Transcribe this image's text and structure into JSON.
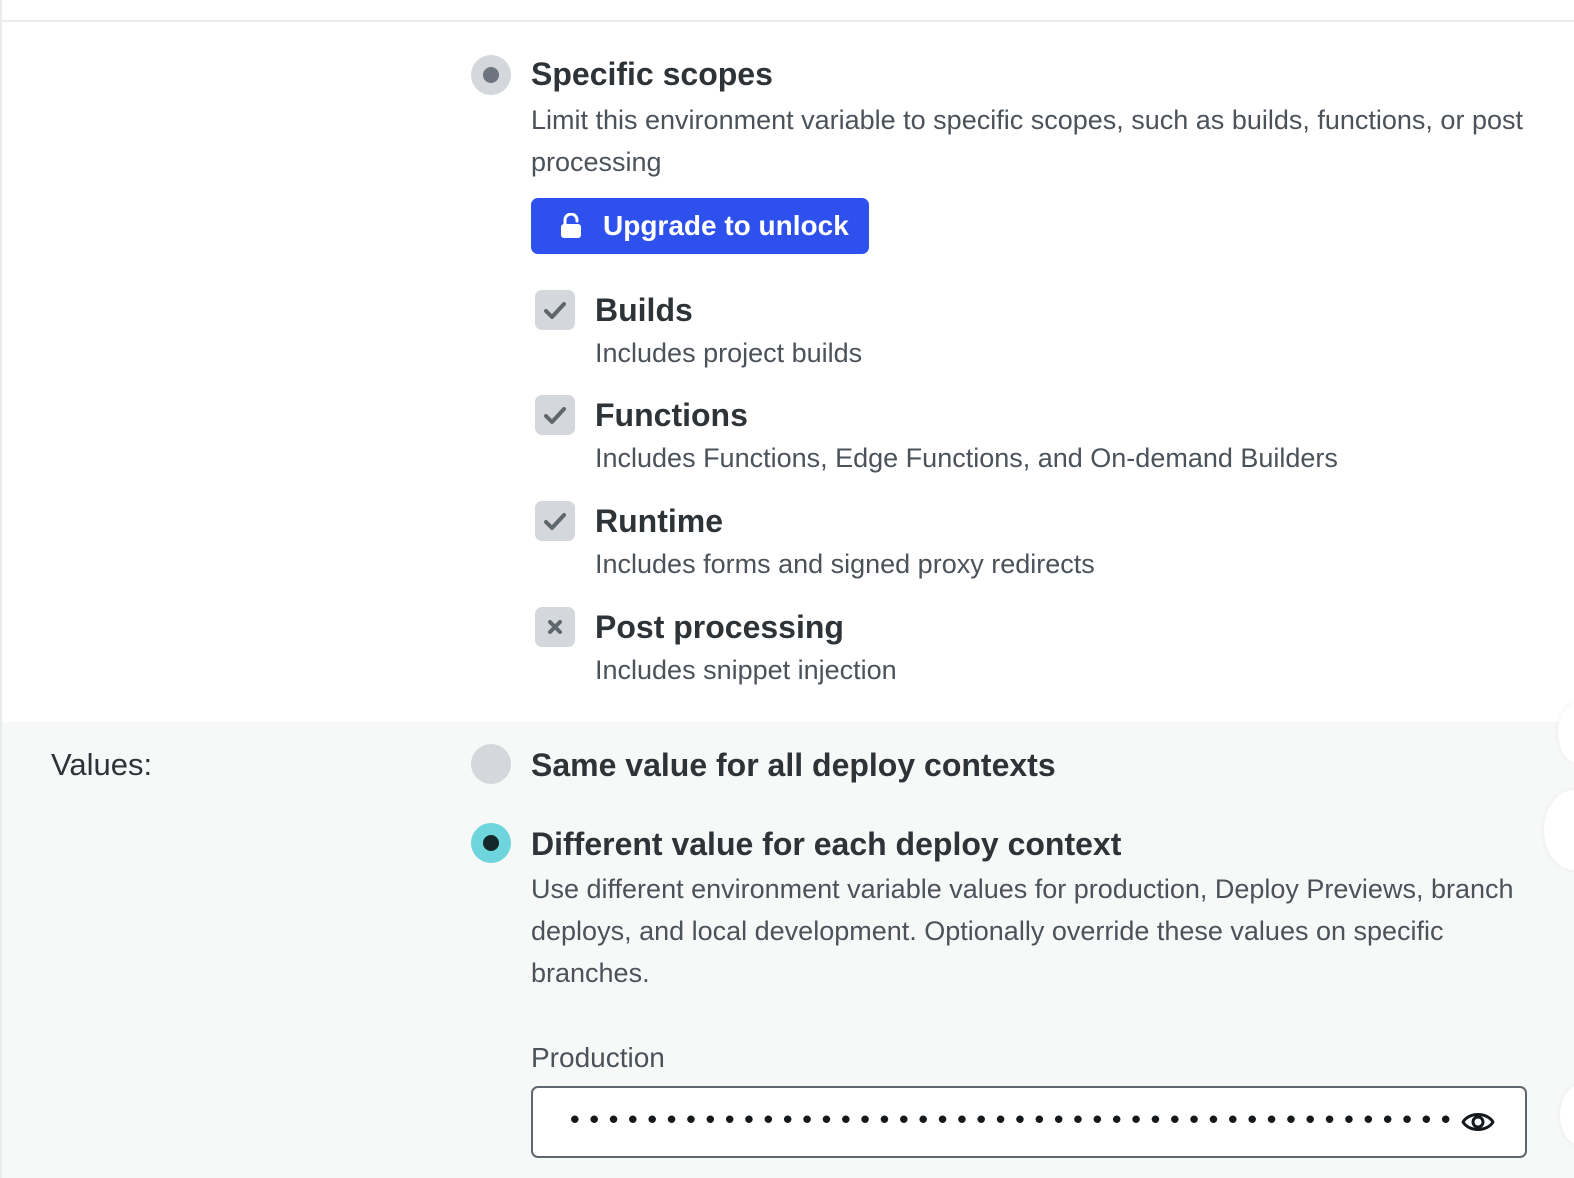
{
  "scope_option": {
    "title": "Specific scopes",
    "description": "Limit this environment variable to specific scopes, such as builds, functions, or post processing",
    "upgrade_label": "Upgrade to unlock",
    "upgrade_color": "#2e51ed",
    "upgrade_icon": "lock-icon"
  },
  "scopes": [
    {
      "title": "Builds",
      "description": "Includes project builds",
      "state": "checked",
      "icon": "check-icon"
    },
    {
      "title": "Functions",
      "description": "Includes Functions, Edge Functions, and On-demand Builders",
      "state": "checked",
      "icon": "check-icon"
    },
    {
      "title": "Runtime",
      "description": "Includes forms and signed proxy redirects",
      "state": "checked",
      "icon": "check-icon"
    },
    {
      "title": "Post processing",
      "description": "Includes snippet injection",
      "state": "excluded",
      "icon": "x-icon"
    }
  ],
  "values": {
    "label": "Values:",
    "options": [
      {
        "title": "Same value for all deploy contexts",
        "selected": false
      },
      {
        "title": "Different value for each deploy context",
        "selected": true,
        "description": "Use different environment variable values for production, Deploy Previews, branch deploys, and local development. Optionally override these values on specific branches."
      }
    ],
    "selected_color": "#6dd5db"
  },
  "production": {
    "label": "Production",
    "masked_value": "••••••••••••••••••••••••••••••••••••••••••••••",
    "reveal_icon": "eye-icon"
  }
}
